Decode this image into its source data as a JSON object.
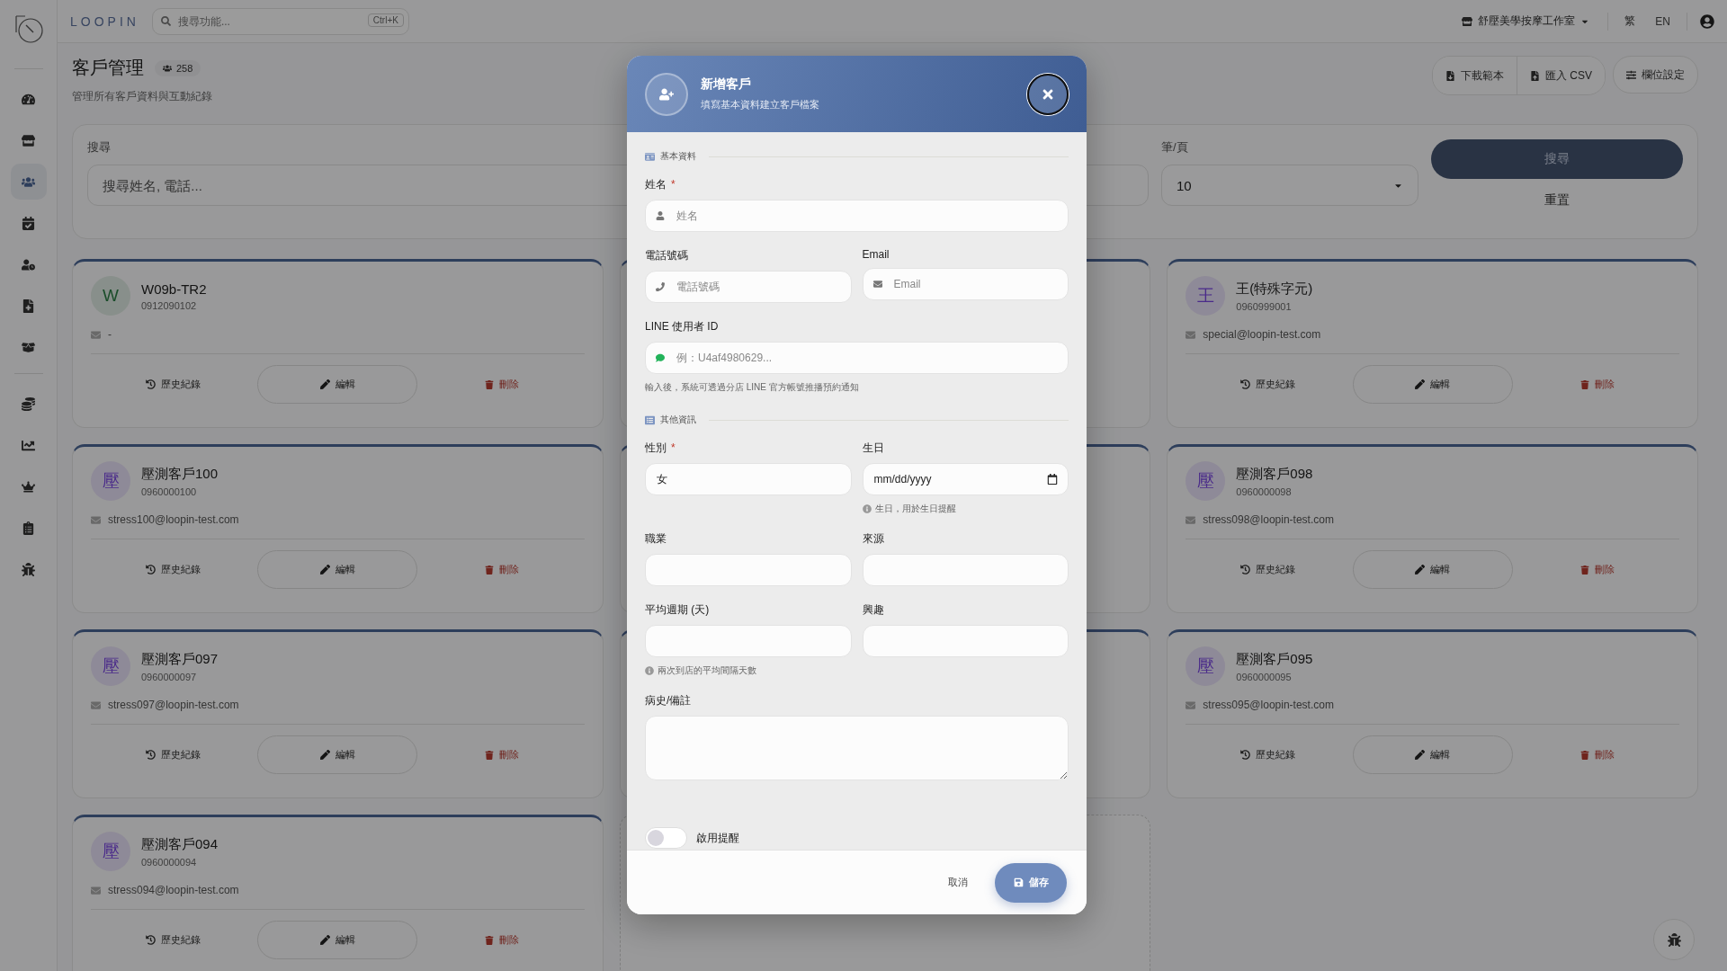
{
  "topbar": {
    "brand": "LOOPIN",
    "search": {
      "placeholder": "搜尋功能...",
      "shortcut": "Ctrl+K"
    },
    "store": "舒壓美學按摩工作室",
    "languages": [
      "繁",
      "EN"
    ]
  },
  "sidebar": {
    "groups": [
      [
        {
          "kind": "dashboard",
          "selected": false
        },
        {
          "kind": "store",
          "selected": false
        },
        {
          "kind": "customers",
          "selected": true
        },
        {
          "kind": "calendar",
          "selected": false
        },
        {
          "kind": "staff",
          "selected": false
        },
        {
          "kind": "records",
          "selected": false
        },
        {
          "kind": "packages",
          "selected": false
        }
      ],
      [
        {
          "kind": "coins",
          "selected": false
        },
        {
          "kind": "chart",
          "selected": false
        },
        {
          "kind": "crown",
          "selected": false
        },
        {
          "kind": "clipboard",
          "selected": false
        },
        {
          "kind": "bug",
          "selected": false
        }
      ]
    ]
  },
  "page": {
    "title": "客戶管理",
    "count": "258",
    "subtitle": "管理所有客戶資料與互動紀錄",
    "actions": [
      {
        "kind": "download",
        "label": "下載範本"
      },
      {
        "kind": "import",
        "label": "匯入 CSV"
      },
      {
        "kind": "columns",
        "label": "欄位設定"
      }
    ]
  },
  "filters": {
    "search_label": "搜尋",
    "search_placeholder": "搜尋姓名, 電話...",
    "page_size_label": "筆/頁",
    "page_size": "10",
    "search_button": "搜尋",
    "reset_button": "重置"
  },
  "customers": [
    {
      "kind": "customer",
      "initial": "W",
      "color": "#1b4d2a",
      "name": "W09b-TR2",
      "phone": "0912090102",
      "email": "-",
      "actions": [
        "歷史紀錄",
        "編輯",
        "刪除"
      ]
    },
    {
      "kind": "covered"
    },
    {
      "kind": "customer",
      "initial": "王",
      "color": "#4a2a8a",
      "name": "王(特殊字元)",
      "phone": "0960999001",
      "email": "special@loopin-test.com",
      "actions": [
        "歷史紀錄",
        "編輯",
        "刪除"
      ]
    },
    {
      "kind": "customer",
      "initial": "壓",
      "color": "#4a2a8a",
      "name": "壓測客戶100",
      "phone": "0960000100",
      "email": "stress100@loopin-test.com",
      "actions": [
        "歷史紀錄",
        "編輯",
        "刪除"
      ]
    },
    {
      "kind": "covered"
    },
    {
      "kind": "customer",
      "initial": "壓",
      "color": "#4a2a8a",
      "name": "壓測客戶098",
      "phone": "0960000098",
      "email": "stress098@loopin-test.com",
      "actions": [
        "歷史紀錄",
        "編輯",
        "刪除"
      ]
    },
    {
      "kind": "customer",
      "initial": "壓",
      "color": "#4a2a8a",
      "name": "壓測客戶097",
      "phone": "0960000097",
      "email": "stress097@loopin-test.com",
      "actions": [
        "歷史紀錄",
        "編輯",
        "刪除"
      ]
    },
    {
      "kind": "covered"
    },
    {
      "kind": "customer",
      "initial": "壓",
      "color": "#4a2a8a",
      "name": "壓測客戶095",
      "phone": "0960000095",
      "email": "stress095@loopin-test.com",
      "actions": [
        "歷史紀錄",
        "編輯",
        "刪除"
      ]
    },
    {
      "kind": "customer",
      "initial": "壓",
      "color": "#4a2a8a",
      "name": "壓測客戶094",
      "phone": "0960000094",
      "email": "stress094@loopin-test.com",
      "actions": [
        "歷史紀錄",
        "編輯",
        "刪除"
      ]
    },
    {
      "kind": "add"
    }
  ],
  "dialog": {
    "title": "新增客戶",
    "subtitle": "填寫基本資料建立客戶檔案",
    "sections": [
      {
        "kind": "basic",
        "title": "基本資料",
        "rows": [
          [
            {
              "kind": "text",
              "label": "姓名",
              "mark": "*",
              "placeholder": "姓名"
            }
          ],
          [
            {
              "kind": "text",
              "label": "電話號碼",
              "placeholder": "電話號碼"
            },
            {
              "kind": "text",
              "label": "Email",
              "placeholder": "Email"
            }
          ],
          [
            {
              "kind": "text",
              "label": "LINE 使用者 ID",
              "placeholder": "例：U4af4980629...",
              "hint": "輸入後，系統可透過分店 LINE 官方帳號推播預約通知"
            }
          ]
        ]
      },
      {
        "kind": "other",
        "title": "其他資訊",
        "rows": [
          [
            {
              "kind": "select",
              "label": "性別",
              "mark": "*",
              "value": "女"
            },
            {
              "kind": "date",
              "label": "生日",
              "placeholder": "mm/dd/yyyy",
              "info": "生日，用於生日提醒"
            }
          ],
          [
            {
              "kind": "text",
              "label": "職業"
            },
            {
              "kind": "text",
              "label": "來源"
            }
          ],
          [
            {
              "kind": "text",
              "label": "平均週期 (天)",
              "info": "兩次到店的平均間隔天數"
            },
            {
              "kind": "text",
              "label": "興趣"
            }
          ],
          [
            {
              "kind": "textarea",
              "label": "病史/備註"
            }
          ]
        ]
      }
    ],
    "toggle": {
      "label": "啟用提醒",
      "on": false
    },
    "cancel": "取消",
    "save": "儲存"
  }
}
